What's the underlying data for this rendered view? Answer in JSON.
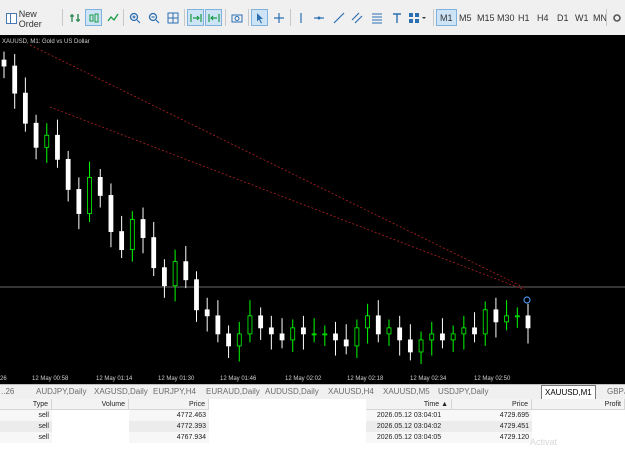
{
  "toolbar": {
    "new_order_label": "New Order",
    "buttons": [
      "algo-trading-icon",
      "bar-chart-icon",
      "candlestick-icon",
      "line-chart-icon",
      "zoom-in-icon",
      "zoom-out-icon",
      "grid-icon",
      "autoscroll-icon",
      "chart-shift-icon",
      "screenshot-icon",
      "cursor-icon",
      "crosshair-icon",
      "vertical-line-icon",
      "horizontal-line-icon",
      "trendline-icon",
      "channel-icon",
      "fibonacci-icon",
      "text-icon",
      "shapes-icon"
    ],
    "timeframes": [
      "M1",
      "M5",
      "M15",
      "M30",
      "H1",
      "H4",
      "D1",
      "W1",
      "MN"
    ],
    "active_timeframe": "M1"
  },
  "chart": {
    "title": "XAUUSD, M1:  Gold vs US Dollar",
    "time_labels": [
      "26",
      "12 May 00:58",
      "12 May 01:14",
      "12 May 01:30",
      "12 May 01:46",
      "12 May 02:02",
      "12 May 02:18",
      "12 May 02:34",
      "12 May 02:50"
    ],
    "background": "#000000",
    "bull_color": "#00ff00",
    "bear_color": "#ffffff",
    "chart_data": {
      "type": "line",
      "series": [
        {
          "values": [
            4772.5,
            4768,
            4763,
            4759,
            4761,
            4757,
            4752,
            4748,
            4754,
            4751,
            4745,
            4742,
            4747,
            4744,
            4739,
            4736,
            4740,
            4737,
            4732,
            4731,
            4728,
            4726,
            4728,
            4731,
            4729,
            4728,
            4727,
            4729,
            4728,
            4728,
            4728,
            4727,
            4726,
            4729,
            4731,
            4728,
            4729,
            4727,
            4725,
            4727,
            4728,
            4727,
            4728,
            4729,
            4728,
            4732,
            4730,
            4731,
            4731,
            4729
          ]
        }
      ]
    }
  },
  "tabs": {
    "items": [
      "..26",
      "AUDJPY,Daily",
      "XAGUSD,Daily",
      "EURJPY,H4",
      "EURAUD,Daily",
      "AUDUSD,Daily",
      "XAUUSD,H4",
      "XAUUSD,M5",
      "USDJPY,Daily",
      "XAUUSD,M1",
      "GBPJP"
    ],
    "active_index": 9
  },
  "orders": {
    "headers": [
      "Type",
      "Volume",
      "Price"
    ],
    "rows": [
      [
        "sell",
        "",
        "4772.463"
      ],
      [
        "sell",
        "",
        "4772.393"
      ],
      [
        "sell",
        "",
        "4767.934"
      ]
    ]
  },
  "deals": {
    "headers": [
      "Time",
      "Price",
      "Profit"
    ],
    "rows": [
      [
        "2026.05.12 03:04:01",
        "4729.695",
        ""
      ],
      [
        "2026.05.12 03:04:02",
        "4729.451",
        ""
      ],
      [
        "2026.05.12 03:04:05",
        "4729.120",
        ""
      ]
    ]
  },
  "watermark": "Activat"
}
